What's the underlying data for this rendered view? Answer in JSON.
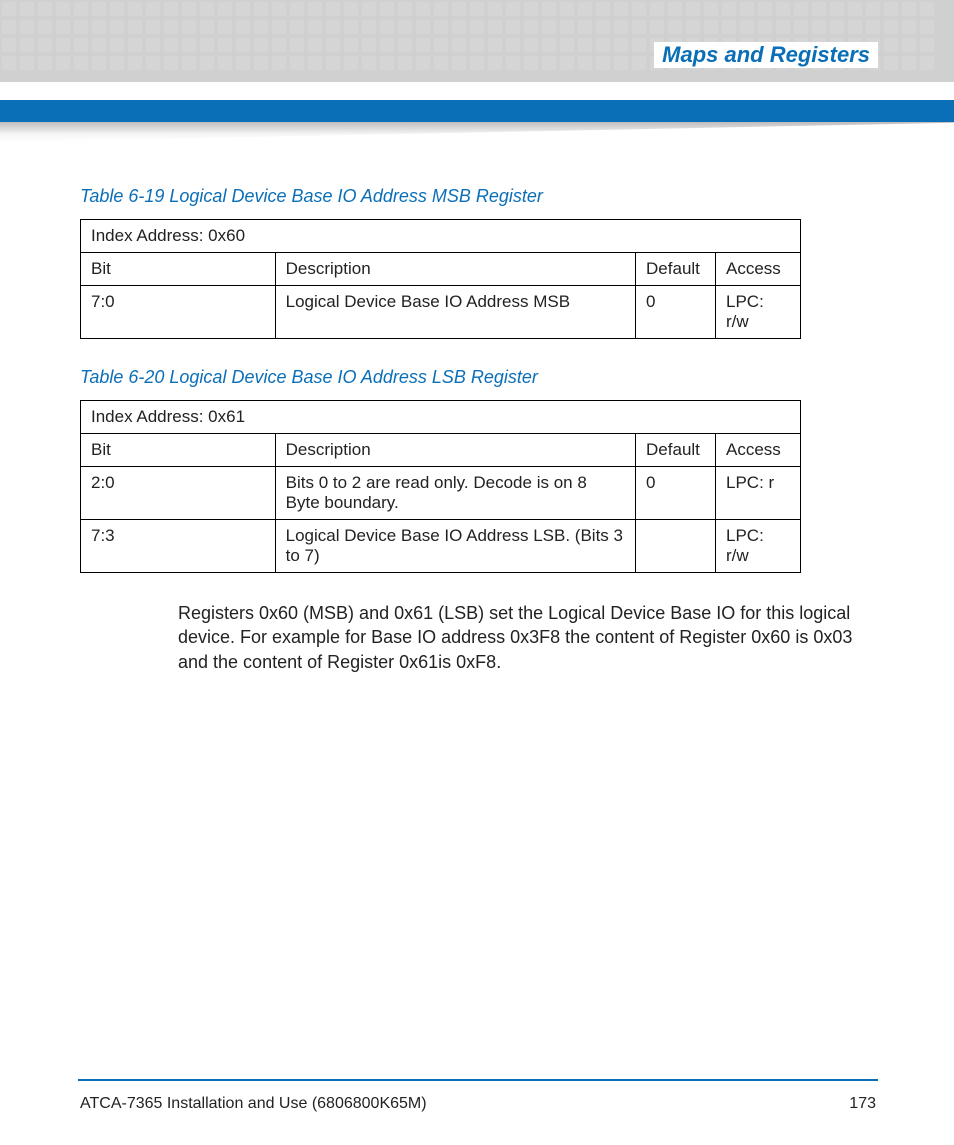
{
  "header": {
    "section_title": "Maps and Registers"
  },
  "table1": {
    "caption": "Table 6-19 Logical Device Base IO Address MSB Register",
    "index_address": "Index Address: 0x60",
    "headers": {
      "bit": "Bit",
      "description": "Description",
      "default": "Default",
      "access": "Access"
    },
    "rows": [
      {
        "bit": "7:0",
        "description": "Logical Device Base IO Address MSB",
        "default": "0",
        "access": "LPC: r/w"
      }
    ]
  },
  "table2": {
    "caption": "Table 6-20 Logical Device Base IO Address LSB Register",
    "index_address": "Index Address: 0x61",
    "headers": {
      "bit": "Bit",
      "description": "Description",
      "default": "Default",
      "access": "Access"
    },
    "rows": [
      {
        "bit": "2:0",
        "description": "Bits 0 to 2 are read only. Decode is on 8 Byte boundary.",
        "default": "0",
        "access": "LPC: r"
      },
      {
        "bit": "7:3",
        "description": "Logical Device Base IO Address LSB. (Bits 3 to 7)",
        "default": "",
        "access": "LPC: r/w"
      }
    ]
  },
  "body_text": "Registers 0x60 (MSB) and 0x61 (LSB) set the Logical Device Base IO for this logical device. For example for Base IO address 0x3F8 the content of Register 0x60 is 0x03 and the content of Register 0x61is 0xF8.",
  "footer": {
    "doc_title": "ATCA-7365 Installation and Use (6806800K65M)",
    "page_number": "173"
  }
}
